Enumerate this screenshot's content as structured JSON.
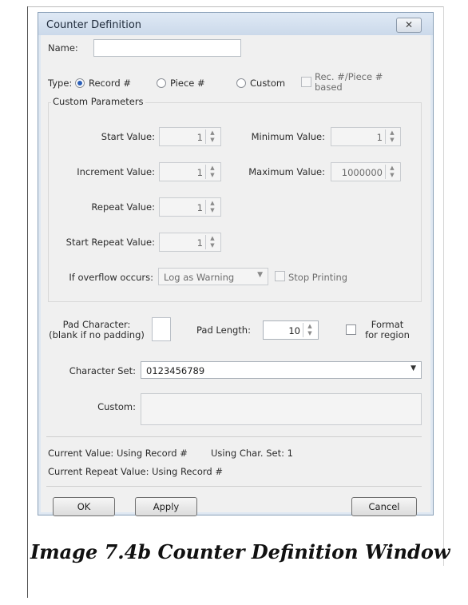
{
  "window": {
    "title": "Counter Definition",
    "close_glyph": "✕"
  },
  "name_field": {
    "label": "Name:",
    "value": ""
  },
  "type": {
    "label": "Type:",
    "options": [
      "Record #",
      "Piece #",
      "Custom"
    ],
    "selected": "Record #",
    "rec_piece_based_label": "Rec. #/Piece # based"
  },
  "custom_parameters": {
    "title": "Custom Parameters",
    "start_value": {
      "label": "Start Value:",
      "value": "1"
    },
    "minimum_value": {
      "label": "Minimum Value:",
      "value": "1"
    },
    "increment_value": {
      "label": "Increment Value:",
      "value": "1"
    },
    "maximum_value": {
      "label": "Maximum Value:",
      "value": "1000000"
    },
    "repeat_value": {
      "label": "Repeat Value:",
      "value": "1"
    },
    "start_repeat_value": {
      "label": "Start Repeat Value:",
      "value": "1"
    },
    "overflow": {
      "label": "If overflow occurs:",
      "value": "Log as Warning"
    },
    "stop_printing_label": "Stop Printing"
  },
  "padding": {
    "pad_character_label_line1": "Pad Character:",
    "pad_character_label_line2": "(blank if no padding)",
    "pad_character_value": "",
    "pad_length_label": "Pad Length:",
    "pad_length_value": "10",
    "format_region_line1": "Format",
    "format_region_line2": "for region"
  },
  "character_set": {
    "label": "Character Set:",
    "value": "0123456789"
  },
  "custom": {
    "label": "Custom:",
    "value": ""
  },
  "status": {
    "current_value": "Current Value:  Using Record #",
    "char_set": "Using Char. Set:  1",
    "current_repeat_value": "Current Repeat Value:  Using Record #"
  },
  "buttons": {
    "ok": "OK",
    "apply": "Apply",
    "cancel": "Cancel"
  },
  "caption": "Image 7.4b Counter Definition Window",
  "icons": {
    "close": "close-icon",
    "spin": "spin-arrows-icon",
    "dropdown": "chevron-down-icon"
  }
}
